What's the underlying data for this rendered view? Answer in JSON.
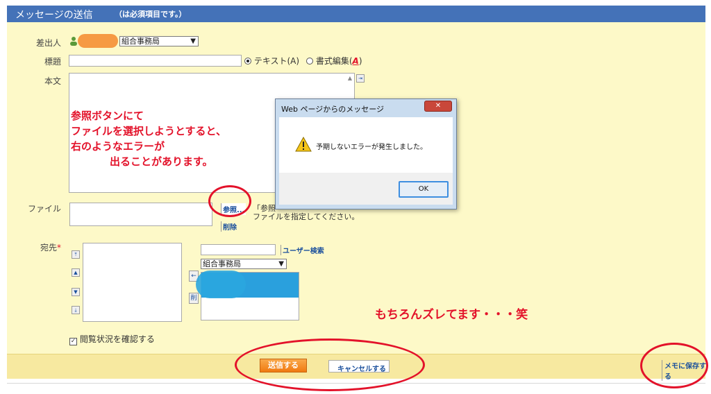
{
  "header": {
    "title": "メッセージの送信",
    "required_note": "（は必須項目です。）"
  },
  "form": {
    "sender_label": "差出人",
    "sender_org": "組合事務局",
    "subject_label": "標題",
    "subject_value": "",
    "format_text": "テキスト(A)",
    "format_rich": "書式編集(",
    "body_label": "本文",
    "file_label": "ファイル",
    "browse_button": "参照...",
    "delete_button": "削除",
    "file_hint_1": "「参照",
    "file_hint_2": "ファイルを指定してください。",
    "recipient_label": "宛先",
    "required_mark": "*",
    "user_search_button": "ユーザー検索",
    "group_select": "組合事務局",
    "read_check_label": "閲覧状況を確認する"
  },
  "footer": {
    "send_button": "送信する",
    "cancel_button": "キャンセルする",
    "save_memo_button": "メモに保存する"
  },
  "annotations": {
    "note_1": "参照ボタンにて",
    "note_2": "ファイルを選択しようとすると、",
    "note_3": "右のようなエラーが",
    "note_4": "出ることがあります。",
    "note_misaligned": "もちろんズレてます・・・笑"
  },
  "dialog": {
    "title": "Web ページからのメッセージ",
    "close": "✕",
    "message": "予期しないエラーが発生しました。",
    "ok_button": "OK"
  },
  "colors": {
    "header_bg": "#4472b8",
    "form_bg": "#fdf9c8",
    "footer_bg": "#f7e9a0",
    "annotation_red": "#e3122a",
    "send_orange": "#f08a20",
    "redact_orange": "#f58a2b",
    "redact_blue": "#2aa6df"
  }
}
